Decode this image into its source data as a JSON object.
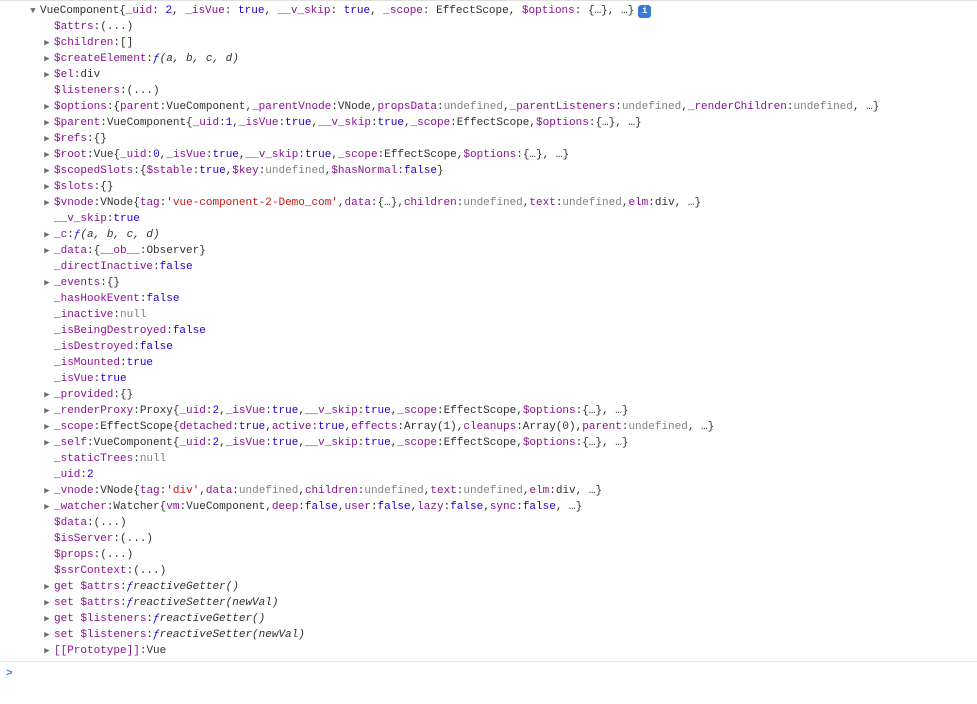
{
  "header": {
    "constructor": "VueComponent",
    "summary": [
      {
        "k": "_uid",
        "v": "2",
        "t": "num"
      },
      {
        "k": "_isVue",
        "v": "true",
        "t": "bool"
      },
      {
        "k": "__v_skip",
        "v": "true",
        "t": "bool"
      },
      {
        "k": "_scope",
        "v": "EffectScope",
        "t": "obj"
      },
      {
        "k": "$options",
        "v": "{…}",
        "t": "obj"
      },
      {
        "k": null,
        "v": "…",
        "t": "obj"
      }
    ]
  },
  "lines": [
    {
      "arrow": false,
      "key": "$attrs",
      "text": [
        {
          "v": "(...)",
          "t": "obj"
        }
      ]
    },
    {
      "arrow": true,
      "key": "$children",
      "text": [
        {
          "v": "[]",
          "t": "obj"
        }
      ]
    },
    {
      "arrow": true,
      "key": "$createElement",
      "text": [
        {
          "v": "ƒ ",
          "t": "f-sym"
        },
        {
          "v": "(a, b, c, d)",
          "t": "func"
        }
      ]
    },
    {
      "arrow": true,
      "key": "$el",
      "text": [
        {
          "v": "div",
          "t": "obj"
        }
      ]
    },
    {
      "arrow": false,
      "key": "$listeners",
      "text": [
        {
          "v": "(...)",
          "t": "obj"
        }
      ]
    },
    {
      "arrow": true,
      "key": "$options",
      "kv": [
        {
          "pre": "{",
          "k": "parent",
          "v": "VueComponent",
          "t": "obj"
        },
        {
          "k": "_parentVnode",
          "v": "VNode",
          "t": "obj"
        },
        {
          "k": "propsData",
          "v": "undefined",
          "t": "undef"
        },
        {
          "k": "_parentListeners",
          "v": "undefined",
          "t": "undef"
        },
        {
          "k": "_renderChildren",
          "v": "undefined",
          "t": "undef"
        },
        {
          "raw": ", …}",
          "t": "obj"
        }
      ]
    },
    {
      "arrow": true,
      "key": "$parent",
      "text": [
        {
          "v": "VueComponent ",
          "t": "obj"
        }
      ],
      "kv": [
        {
          "pre": "{",
          "k": "_uid",
          "v": "1",
          "t": "num"
        },
        {
          "k": "_isVue",
          "v": "true",
          "t": "bool"
        },
        {
          "k": "__v_skip",
          "v": "true",
          "t": "bool"
        },
        {
          "k": "_scope",
          "v": "EffectScope",
          "t": "obj"
        },
        {
          "k": "$options",
          "v": "{…}",
          "t": "obj"
        },
        {
          "raw": ", …}",
          "t": "obj"
        }
      ]
    },
    {
      "arrow": true,
      "key": "$refs",
      "text": [
        {
          "v": "{}",
          "t": "obj"
        }
      ]
    },
    {
      "arrow": true,
      "key": "$root",
      "text": [
        {
          "v": "Vue ",
          "t": "obj"
        }
      ],
      "kv": [
        {
          "pre": "{",
          "k": "_uid",
          "v": "0",
          "t": "num"
        },
        {
          "k": "_isVue",
          "v": "true",
          "t": "bool"
        },
        {
          "k": "__v_skip",
          "v": "true",
          "t": "bool"
        },
        {
          "k": "_scope",
          "v": "EffectScope",
          "t": "obj"
        },
        {
          "k": "$options",
          "v": "{…}",
          "t": "obj"
        },
        {
          "raw": ", …}",
          "t": "obj"
        }
      ]
    },
    {
      "arrow": true,
      "key": "$scopedSlots",
      "kv": [
        {
          "pre": "{",
          "k": "$stable",
          "v": "true",
          "t": "bool"
        },
        {
          "k": "$key",
          "v": "undefined",
          "t": "undef"
        },
        {
          "k": "$hasNormal",
          "v": "false",
          "t": "bool"
        },
        {
          "raw": "}",
          "t": "obj"
        }
      ]
    },
    {
      "arrow": true,
      "key": "$slots",
      "text": [
        {
          "v": "{}",
          "t": "obj"
        }
      ]
    },
    {
      "arrow": true,
      "key": "$vnode",
      "text": [
        {
          "v": "VNode ",
          "t": "obj"
        }
      ],
      "kv": [
        {
          "pre": "{",
          "k": "tag",
          "v": "'vue-component-2-Demo_com'",
          "t": "str"
        },
        {
          "k": "data",
          "v": "{…}",
          "t": "obj"
        },
        {
          "k": "children",
          "v": "undefined",
          "t": "undef"
        },
        {
          "k": "text",
          "v": "undefined",
          "t": "undef"
        },
        {
          "k": "elm",
          "v": "div",
          "t": "obj"
        },
        {
          "raw": ", …}",
          "t": "obj"
        }
      ]
    },
    {
      "arrow": false,
      "key": "__v_skip",
      "text": [
        {
          "v": "true",
          "t": "bool"
        }
      ]
    },
    {
      "arrow": true,
      "key": "_c",
      "text": [
        {
          "v": "ƒ ",
          "t": "f-sym"
        },
        {
          "v": "(a, b, c, d)",
          "t": "func"
        }
      ]
    },
    {
      "arrow": true,
      "key": "_data",
      "kv": [
        {
          "pre": "{",
          "k": "__ob__",
          "v": "Observer",
          "t": "obj"
        },
        {
          "raw": "}",
          "t": "obj"
        }
      ]
    },
    {
      "arrow": false,
      "key": "_directInactive",
      "text": [
        {
          "v": "false",
          "t": "bool"
        }
      ]
    },
    {
      "arrow": true,
      "key": "_events",
      "text": [
        {
          "v": "{}",
          "t": "obj"
        }
      ]
    },
    {
      "arrow": false,
      "key": "_hasHookEvent",
      "text": [
        {
          "v": "false",
          "t": "bool"
        }
      ]
    },
    {
      "arrow": false,
      "key": "_inactive",
      "text": [
        {
          "v": "null",
          "t": "null"
        }
      ]
    },
    {
      "arrow": false,
      "key": "_isBeingDestroyed",
      "text": [
        {
          "v": "false",
          "t": "bool"
        }
      ]
    },
    {
      "arrow": false,
      "key": "_isDestroyed",
      "text": [
        {
          "v": "false",
          "t": "bool"
        }
      ]
    },
    {
      "arrow": false,
      "key": "_isMounted",
      "text": [
        {
          "v": "true",
          "t": "bool"
        }
      ]
    },
    {
      "arrow": false,
      "key": "_isVue",
      "text": [
        {
          "v": "true",
          "t": "bool"
        }
      ]
    },
    {
      "arrow": true,
      "key": "_provided",
      "text": [
        {
          "v": "{}",
          "t": "obj"
        }
      ]
    },
    {
      "arrow": true,
      "key": "_renderProxy",
      "text": [
        {
          "v": "Proxy ",
          "t": "obj"
        }
      ],
      "kv": [
        {
          "pre": "{",
          "k": "_uid",
          "v": "2",
          "t": "num"
        },
        {
          "k": "_isVue",
          "v": "true",
          "t": "bool"
        },
        {
          "k": "__v_skip",
          "v": "true",
          "t": "bool"
        },
        {
          "k": "_scope",
          "v": "EffectScope",
          "t": "obj"
        },
        {
          "k": "$options",
          "v": "{…}",
          "t": "obj"
        },
        {
          "raw": ", …}",
          "t": "obj"
        }
      ]
    },
    {
      "arrow": true,
      "key": "_scope",
      "text": [
        {
          "v": "EffectScope ",
          "t": "obj"
        }
      ],
      "kv": [
        {
          "pre": "{",
          "k": "detached",
          "v": "true",
          "t": "bool"
        },
        {
          "k": "active",
          "v": "true",
          "t": "bool"
        },
        {
          "k": "effects",
          "v": "Array(1)",
          "t": "obj"
        },
        {
          "k": "cleanups",
          "v": "Array(0)",
          "t": "obj"
        },
        {
          "k": "parent",
          "v": "undefined",
          "t": "undef"
        },
        {
          "raw": ", …}",
          "t": "obj"
        }
      ]
    },
    {
      "arrow": true,
      "key": "_self",
      "text": [
        {
          "v": "VueComponent ",
          "t": "obj"
        }
      ],
      "kv": [
        {
          "pre": "{",
          "k": "_uid",
          "v": "2",
          "t": "num"
        },
        {
          "k": "_isVue",
          "v": "true",
          "t": "bool"
        },
        {
          "k": "__v_skip",
          "v": "true",
          "t": "bool"
        },
        {
          "k": "_scope",
          "v": "EffectScope",
          "t": "obj"
        },
        {
          "k": "$options",
          "v": "{…}",
          "t": "obj"
        },
        {
          "raw": ", …}",
          "t": "obj"
        }
      ]
    },
    {
      "arrow": false,
      "key": "_staticTrees",
      "text": [
        {
          "v": "null",
          "t": "null"
        }
      ]
    },
    {
      "arrow": false,
      "key": "_uid",
      "text": [
        {
          "v": "2",
          "t": "num"
        }
      ]
    },
    {
      "arrow": true,
      "key": "_vnode",
      "text": [
        {
          "v": "VNode ",
          "t": "obj"
        }
      ],
      "kv": [
        {
          "pre": "{",
          "k": "tag",
          "v": "'div'",
          "t": "str"
        },
        {
          "k": "data",
          "v": "undefined",
          "t": "undef"
        },
        {
          "k": "children",
          "v": "undefined",
          "t": "undef"
        },
        {
          "k": "text",
          "v": "undefined",
          "t": "undef"
        },
        {
          "k": "elm",
          "v": "div",
          "t": "obj"
        },
        {
          "raw": ", …}",
          "t": "obj"
        }
      ]
    },
    {
      "arrow": true,
      "key": "_watcher",
      "text": [
        {
          "v": "Watcher ",
          "t": "obj"
        }
      ],
      "kv": [
        {
          "pre": "{",
          "k": "vm",
          "v": "VueComponent",
          "t": "obj"
        },
        {
          "k": "deep",
          "v": "false",
          "t": "bool"
        },
        {
          "k": "user",
          "v": "false",
          "t": "bool"
        },
        {
          "k": "lazy",
          "v": "false",
          "t": "bool"
        },
        {
          "k": "sync",
          "v": "false",
          "t": "bool"
        },
        {
          "raw": ", …}",
          "t": "obj"
        }
      ]
    },
    {
      "arrow": false,
      "key": "$data",
      "text": [
        {
          "v": "(...)",
          "t": "obj"
        }
      ]
    },
    {
      "arrow": false,
      "key": "$isServer",
      "text": [
        {
          "v": "(...)",
          "t": "obj"
        }
      ]
    },
    {
      "arrow": false,
      "key": "$props",
      "text": [
        {
          "v": "(...)",
          "t": "obj"
        }
      ]
    },
    {
      "arrow": false,
      "key": "$ssrContext",
      "text": [
        {
          "v": "(...)",
          "t": "obj"
        }
      ]
    },
    {
      "arrow": true,
      "key": "get $attrs",
      "text": [
        {
          "v": "ƒ ",
          "t": "f-sym"
        },
        {
          "v": "reactiveGetter()",
          "t": "func"
        }
      ]
    },
    {
      "arrow": true,
      "key": "set $attrs",
      "text": [
        {
          "v": "ƒ ",
          "t": "f-sym"
        },
        {
          "v": "reactiveSetter(newVal)",
          "t": "func"
        }
      ]
    },
    {
      "arrow": true,
      "key": "get $listeners",
      "text": [
        {
          "v": "ƒ ",
          "t": "f-sym"
        },
        {
          "v": "reactiveGetter()",
          "t": "func"
        }
      ]
    },
    {
      "arrow": true,
      "key": "set $listeners",
      "text": [
        {
          "v": "ƒ ",
          "t": "f-sym"
        },
        {
          "v": "reactiveSetter(newVal)",
          "t": "func"
        }
      ]
    },
    {
      "arrow": true,
      "key": "[[Prototype]]",
      "text": [
        {
          "v": "Vue",
          "t": "obj"
        }
      ]
    }
  ],
  "prompt": ">"
}
